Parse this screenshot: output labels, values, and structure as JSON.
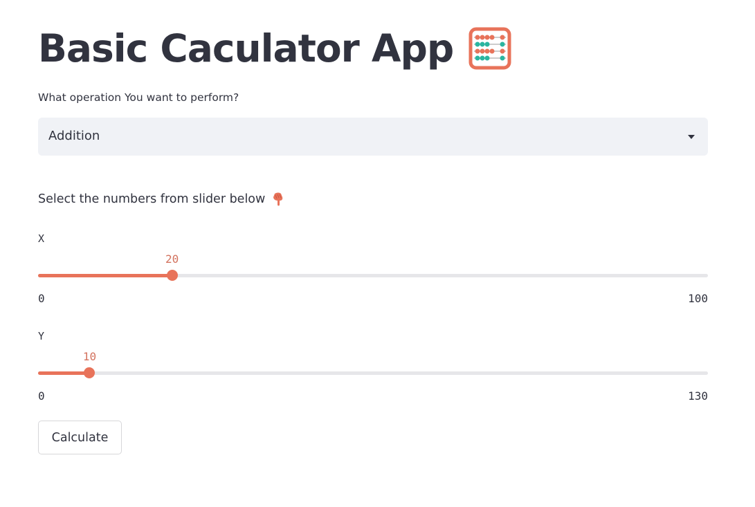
{
  "app": {
    "title": "Basic Caculator App",
    "title_icon": "abacus-icon"
  },
  "operation_select": {
    "label": "What operation You want to perform?",
    "selected": "Addition"
  },
  "instruction": {
    "text": "Select the numbers from slider below",
    "icon": "pointing-down-icon"
  },
  "sliders": [
    {
      "label": "X",
      "value": 20,
      "min": 0,
      "max": 100
    },
    {
      "label": "Y",
      "value": 10,
      "min": 0,
      "max": 130
    }
  ],
  "button": {
    "label": "Calculate"
  },
  "colors": {
    "accent": "#e8735a",
    "text": "#31333f",
    "select_bg": "#f0f2f6",
    "track": "#e6e6e9"
  }
}
